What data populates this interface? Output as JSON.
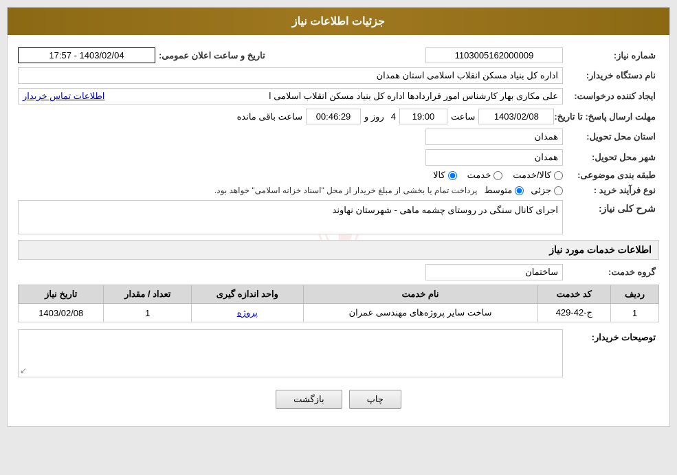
{
  "header": {
    "title": "جزئیات اطلاعات نیاز"
  },
  "fields": {
    "shomare_niaz_label": "شماره نیاز:",
    "shomare_niaz_value": "1103005162000009",
    "nam_dastgah_label": "نام دستگاه خریدار:",
    "nam_dastgah_value": "اداره کل بنیاد مسکن انقلاب اسلامی استان همدان",
    "ijad_konande_label": "ایجاد کننده درخواست:",
    "ijad_konande_value": "علی مکاری بهار کارشناس امور قراردادها اداره کل بنیاد مسکن انقلاب اسلامی ا",
    "ijad_konande_link": "اطلاعات تماس خریدار",
    "mohlat_label": "مهلت ارسال پاسخ: تا تاریخ:",
    "date_value": "1403/02/08",
    "time_label": "ساعت",
    "time_value": "19:00",
    "roz_label": "روز و",
    "roz_value": "4",
    "mande_label": "ساعت باقی مانده",
    "mande_value": "00:46:29",
    "tarikh_elan_label": "تاریخ و ساعت اعلان عمومی:",
    "tarikh_elan_value": "1403/02/04 - 17:57",
    "ostan_label": "استان محل تحویل:",
    "ostan_value": "همدان",
    "shahr_label": "شهر محل تحویل:",
    "shahr_value": "همدان",
    "tabaqe_label": "طبقه بندی موضوعی:",
    "radio_kala": "کالا",
    "radio_khadamat": "خدمت",
    "radio_kala_khadamat": "کالا/خدمت",
    "kala_khadamat_checked": "kala_khadamat",
    "noع_label": "نوع فرآیند خرید :",
    "radio_jozi": "جزئی",
    "radio_motevaset": "متوسط",
    "radio_note": "پرداخت تمام یا بخشی از مبلغ خریدار از محل \"اسناد خزانه اسلامی\" خواهد بود.",
    "sharh_label": "شرح کلی نیاز:",
    "sharh_value": "اجرای کانال سنگی در روستای چشمه ماهی - شهرستان نهاوند",
    "section_khadamat": "اطلاعات خدمات مورد نیاز",
    "gorooh_label": "گروه خدمت:",
    "gorooh_value": "ساختمان",
    "table": {
      "headers": [
        "ردیف",
        "کد خدمت",
        "نام خدمت",
        "واحد اندازه گیری",
        "تعداد / مقدار",
        "تاریخ نیاز"
      ],
      "rows": [
        {
          "radif": "1",
          "kod_khadamat": "ج-42-429",
          "nam_khadamat": "ساخت سایر پروژه‌های مهندسی عمران",
          "vahed": "پروژه",
          "tedad": "1",
          "tarikh": "1403/02/08"
        }
      ]
    },
    "toseeh_label": "توصیحات خریدار:",
    "toseeh_value": "",
    "btn_chap": "چاپ",
    "btn_bazgasht": "بازگشت"
  }
}
